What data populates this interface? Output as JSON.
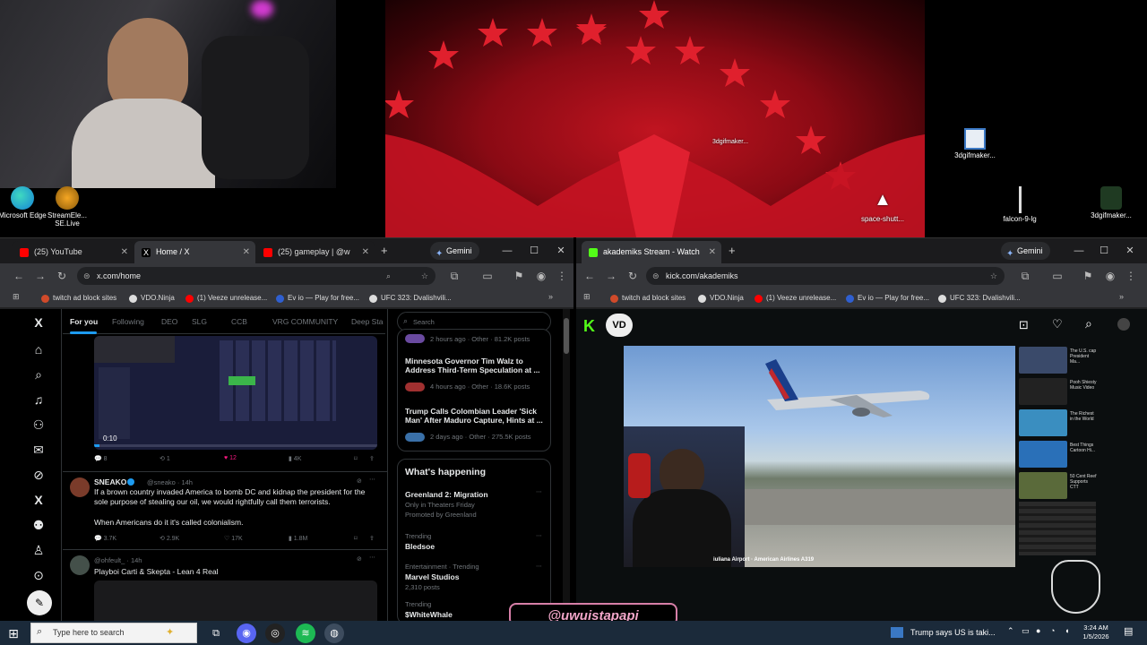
{
  "desktop": {
    "icons": [
      {
        "label": "Microsoft Edge",
        "icon": "edge-icon"
      },
      {
        "label": "StreamEle... SE.Live",
        "icon": "streamelements-icon"
      },
      {
        "label": "3dgifmaker...",
        "icon": "image-file-icon"
      },
      {
        "label": "3dgifmaker...",
        "icon": "image-file-icon"
      },
      {
        "label": "space-shutt...",
        "icon": "shuttle-icon"
      },
      {
        "label": "falcon-9-lg",
        "icon": "rocket-icon"
      },
      {
        "label": "3dgifmaker...",
        "icon": "image-file-icon"
      }
    ]
  },
  "left_browser": {
    "tabs": [
      {
        "label": "(25) YouTube",
        "color": "#ff0000"
      },
      {
        "label": "Home / X",
        "color": "#ffffff"
      },
      {
        "label": "(25) gameplay | @w",
        "color": "#ff0000"
      }
    ],
    "gemini_label": "Gemini",
    "address": "x.com/home",
    "bookmarks": [
      "twitch ad block sites",
      "VDO.Ninja",
      "(1) Veeze unrelease...",
      "Ev io — Play for free...",
      "UFC 323: Dvalishvili..."
    ]
  },
  "x": {
    "feed_tabs": [
      "For you",
      "Following",
      "DEO",
      "SLG",
      "CCB",
      "VRG COMMUNITY",
      "Deep Sta"
    ],
    "video_time": "0:10",
    "tweet1_actions": {
      "replies": "8",
      "reposts": "1",
      "likes": "12",
      "views": "4K"
    },
    "tweet2": {
      "author": "SNEAKO",
      "handle": "@sneako · 14h",
      "text": "If a brown country invaded America to bomb DC and kidnap the president for the sole purpose of stealing our oil, we would rightfully call them terrorists.",
      "text2": "When Americans do it it's called colonialism.",
      "replies": "3.7K",
      "reposts": "2.9K",
      "likes": "17K",
      "views": "1.8M"
    },
    "tweet3": {
      "handle": "@ohfeult_ · 14h",
      "text": "Playboi Carti & Skepta - Lean 4 Real"
    },
    "search_placeholder": "Search",
    "news": [
      {
        "meta": "2 hours ago · Other · 81.2K posts"
      },
      {
        "title": "Minnesota Governor Tim Walz to Address Third-Term Speculation at ...",
        "meta": "4 hours ago · Other · 18.6K posts"
      },
      {
        "title": "Trump Calls Colombian Leader 'Sick Man' After Maduro Capture, Hints at ...",
        "meta": "2 days ago · Other · 275.5K posts"
      }
    ],
    "whats_happening": "What's happening",
    "trends": [
      {
        "title": "Greenland 2: Migration",
        "sub": "Only in Theaters Friday",
        "sub2": "Promoted by Greenland"
      },
      {
        "label": "Trending",
        "title": "Bledsoe"
      },
      {
        "label": "Entertainment · Trending",
        "title": "Marvel Studios",
        "sub": "2,310 posts"
      },
      {
        "label": "Trending",
        "title": "$WhiteWhale"
      }
    ]
  },
  "right_browser": {
    "tab": "akademiks Stream - Watch",
    "gemini_label": "Gemini",
    "address": "kick.com/akademiks",
    "bookmarks": [
      "twitch ad block sites",
      "VDO.Ninja",
      "(1) Veeze unrelease...",
      "Ev io — Play for free...",
      "UFC 323: Dvalishvili..."
    ],
    "player_caption": "iuliana Airport · American Airlines A319",
    "side_items": [
      "The U.S. cap President Ma...",
      "Pooh Shiesty Music Video",
      "The Richest in the World",
      "Best Things Cartoon Hi...",
      "50 Cent Reef Supports CTT"
    ]
  },
  "overlay": {
    "handle": "@uwuistapapi"
  },
  "taskbar": {
    "search_placeholder": "Type here to search",
    "news": "Trump says US is taki...",
    "time": "3:24 AM",
    "date": "1/5/2026"
  }
}
